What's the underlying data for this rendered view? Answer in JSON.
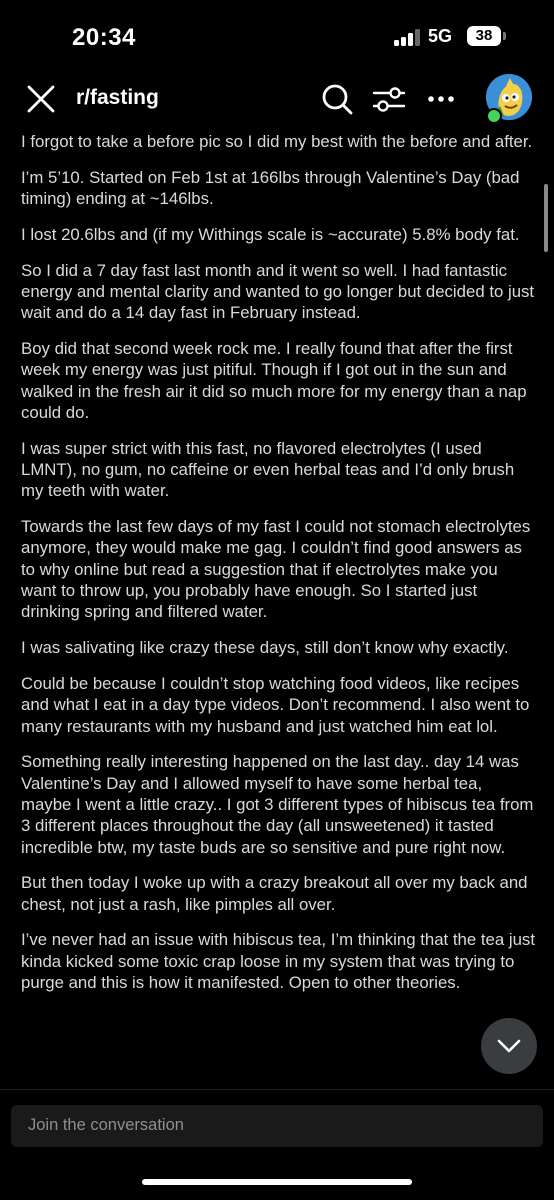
{
  "status_bar": {
    "time": "20:34",
    "network": "5G",
    "battery": "38"
  },
  "header": {
    "subreddit": "r/fasting",
    "icons": [
      "close-icon",
      "search-icon",
      "filter-icon",
      "more-icon",
      "avatar"
    ]
  },
  "post": {
    "paragraphs": [
      "I forgot to take a before pic so I did my best with the before and after.",
      "I’m 5’10. Started on Feb 1st at 166lbs through Valentine’s Day (bad timing) ending at ~146lbs.",
      "I lost 20.6lbs and (if my Withings scale is ~accurate) 5.8% body fat.",
      "So I did a 7 day fast last month and it went so well. I had fantastic energy and mental clarity and wanted to go longer but decided to just wait and do a 14 day fast in February instead.",
      "Boy did that second week rock me. I really found that after the first week my energy was just pitiful. Though if I got out in the sun and walked in the fresh air it did so much more for my energy than a nap could do.",
      "I was super strict with this fast, no flavored electrolytes (I used LMNT), no gum, no caffeine or even herbal teas and I’d only brush my teeth with water.",
      "Towards the last few days of my fast I could not stomach electrolytes anymore, they would make me gag. I couldn’t find good answers as to why online but read a suggestion that if electrolytes make you want to throw up, you probably have enough. So I started just drinking spring and filtered water.",
      "I was salivating like crazy these days, still don’t know why exactly.",
      "Could be because I couldn’t stop watching food videos, like recipes and what I eat in a day type videos. Don’t recommend. I also went to many restaurants with my husband and just watched him eat lol.",
      "Something really interesting happened on the last day.. day 14 was Valentine’s Day and I allowed myself to have some herbal tea, maybe I went a little crazy.. I got 3 different types of hibiscus tea from 3 different places throughout the day (all unsweetened) it tasted incredible btw, my taste buds are so sensitive and pure right now.",
      "But then today I woke up with a crazy breakout all over my back and chest, not just a rash, like pimples all over.",
      "I’ve never had an issue with hibiscus tea, I’m thinking that the tea just kinda kicked some toxic crap loose in my system that was trying to purge and this is how it manifested. Open to other theories."
    ]
  },
  "composer": {
    "placeholder": "Join the conversation"
  },
  "colors": {
    "background": "#000000",
    "text": "#d7dadc",
    "online": "#46d160",
    "avatar_bg": "#3a8fd8"
  }
}
